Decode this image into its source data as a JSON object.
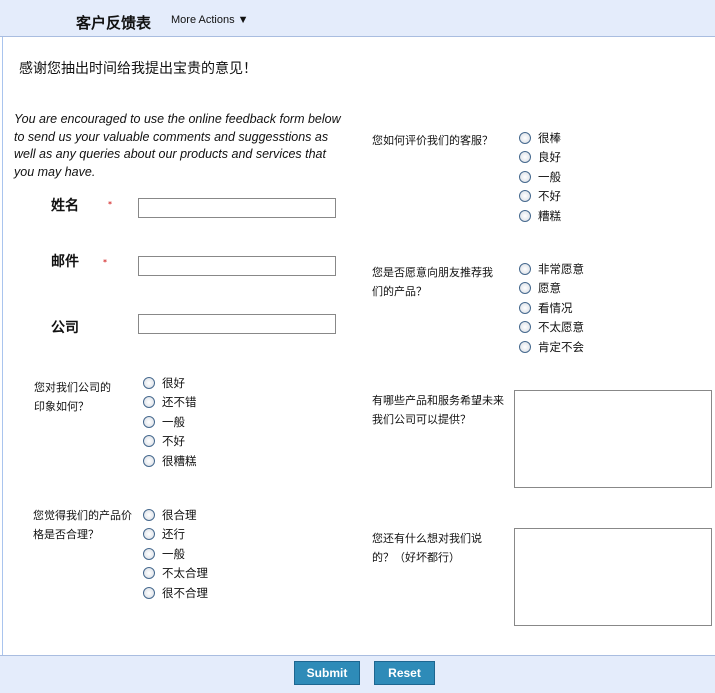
{
  "header": {
    "title": "客户反馈表",
    "more_actions": "More Actions ▼"
  },
  "thanks": "感谢您抽出时间给我提出宝贵的意见！",
  "intro": "You are encouraged to use the online feedback form below to send us your valuable comments and suggesstions as well as any queries about our products and services that you may have.",
  "fields": [
    {
      "label": "姓名",
      "required": "*"
    },
    {
      "label": "邮件",
      "required": "*"
    },
    {
      "label": "公司",
      "required": ""
    }
  ],
  "questions": {
    "impression": {
      "label": "您对我们公司的印象如何？",
      "options": [
        "很好",
        "还不错",
        "一般",
        "不好",
        "很糟糕"
      ]
    },
    "price": {
      "label": "您觉得我们的产品价格是否合理？",
      "options": [
        "很合理",
        "还行",
        "一般",
        "不太合理",
        "很不合理"
      ]
    },
    "service": {
      "label": "您如何评价我们的客服？",
      "options": [
        "很棒",
        "良好",
        "一般",
        "不好",
        "糟糕"
      ]
    },
    "recommend": {
      "label": "您是否愿意向朋友推荐我们的产品？",
      "options": [
        "非常愿意",
        "愿意",
        "看情况",
        "不太愿意",
        "肯定不会"
      ]
    },
    "future": {
      "label": "有哪些产品和服务希望未来我们公司可以提供？"
    },
    "other": {
      "label": "您还有什么想对我们说的？（好坏都行）"
    }
  },
  "buttons": {
    "submit": "Submit",
    "reset": "Reset"
  }
}
